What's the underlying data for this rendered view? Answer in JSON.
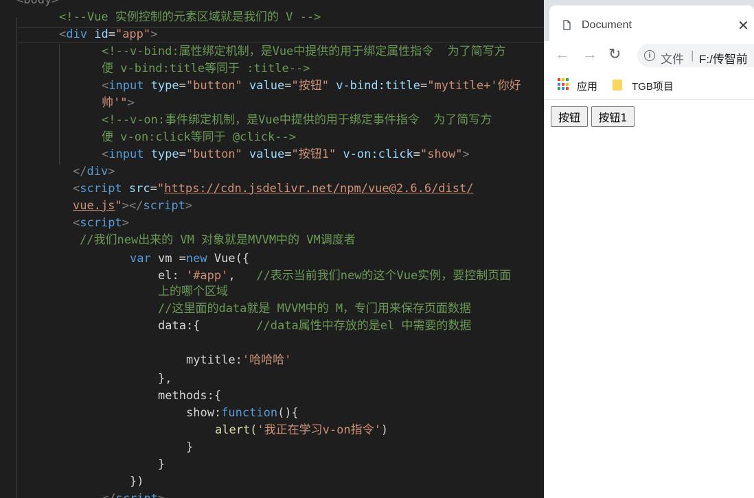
{
  "editor": {
    "lines": [
      [
        "<body>"
      ],
      [
        "<!--Vue 实例控制的元素区域就是我们的 V -->"
      ],
      [
        "<",
        "div",
        " ",
        "id",
        "=",
        "\"app\"",
        ">"
      ],
      [
        "<!--v-bind:属性绑定机制，是Vue中提供的用于绑定属性指令  为了简写方"
      ],
      [
        "便 v-bind:title等同于 :title-->"
      ],
      [
        "<",
        "input",
        " ",
        "type",
        "=",
        "\"button\"",
        " ",
        "value",
        "=",
        "\"按钮\"",
        " ",
        "v-bind:title",
        "=",
        "\"mytitle+'你好"
      ],
      [
        "帅'\"",
        ">"
      ],
      [
        "<!--v-on:事件绑定机制，是Vue中提供的用于绑定事件指令  为了简写方"
      ],
      [
        "便 v-on:click等同于 @click-->"
      ],
      [
        "<",
        "input",
        " ",
        "type",
        "=",
        "\"button\"",
        " ",
        "value",
        "=",
        "\"按钮1\"",
        " ",
        "v-on:click",
        "=",
        "\"show\"",
        ">"
      ],
      [
        "</",
        "div",
        ">"
      ],
      [
        "<",
        "script",
        " ",
        "src",
        "=",
        "\"",
        "https://cdn.jsdelivr.net/npm/vue@2.6.6/dist/"
      ],
      [
        "vue.js",
        "\"",
        "></",
        "script",
        ">"
      ],
      [
        "<",
        "script",
        ">"
      ],
      [
        "//我们new出来的 VM 对象就是MVVM中的 VM调度者"
      ],
      [
        "var",
        " vm =",
        "new",
        " Vue({"
      ],
      [
        "el: ",
        "'#app'",
        ",   ",
        "//表示当前我们new的这个Vue实例，要控制页面"
      ],
      [
        "上的哪个区域"
      ],
      [
        "//这里面的data就是 MVVM中的 M，专门用来保存页面数据"
      ],
      [
        "data:{        ",
        "//data属性中存放的是el 中需要的数据"
      ],
      [
        ""
      ],
      [
        "mytitle:",
        "'哈哈哈'"
      ],
      [
        "},"
      ],
      [
        "methods:{"
      ],
      [
        "show:",
        "function",
        "(){"
      ],
      [
        "alert(",
        "'我正在学习v-on指令'",
        ")"
      ],
      [
        "}"
      ],
      [
        "}"
      ],
      [
        "})"
      ],
      [
        "</",
        "script",
        ">"
      ]
    ]
  },
  "browser": {
    "tab_title": "Document",
    "close_glyph": "✕",
    "back_glyph": "←",
    "forward_glyph": "→",
    "reload_glyph": "↻",
    "info_glyph": "i",
    "address_label": "文件",
    "address_separator": "|",
    "address_url": "F:/传智前",
    "bookmarks": {
      "apps_label": "应用",
      "folder_label": "TGB项目"
    },
    "page": {
      "button1_value": "按钮",
      "button2_value": "按钮1"
    },
    "colors": {
      "apps_icon": [
        "#ea4335",
        "#fbbc05",
        "#34a853",
        "#4285f4",
        "#ea4335",
        "#fbbc05",
        "#34a853",
        "#4285f4",
        "#ea4335"
      ]
    }
  }
}
